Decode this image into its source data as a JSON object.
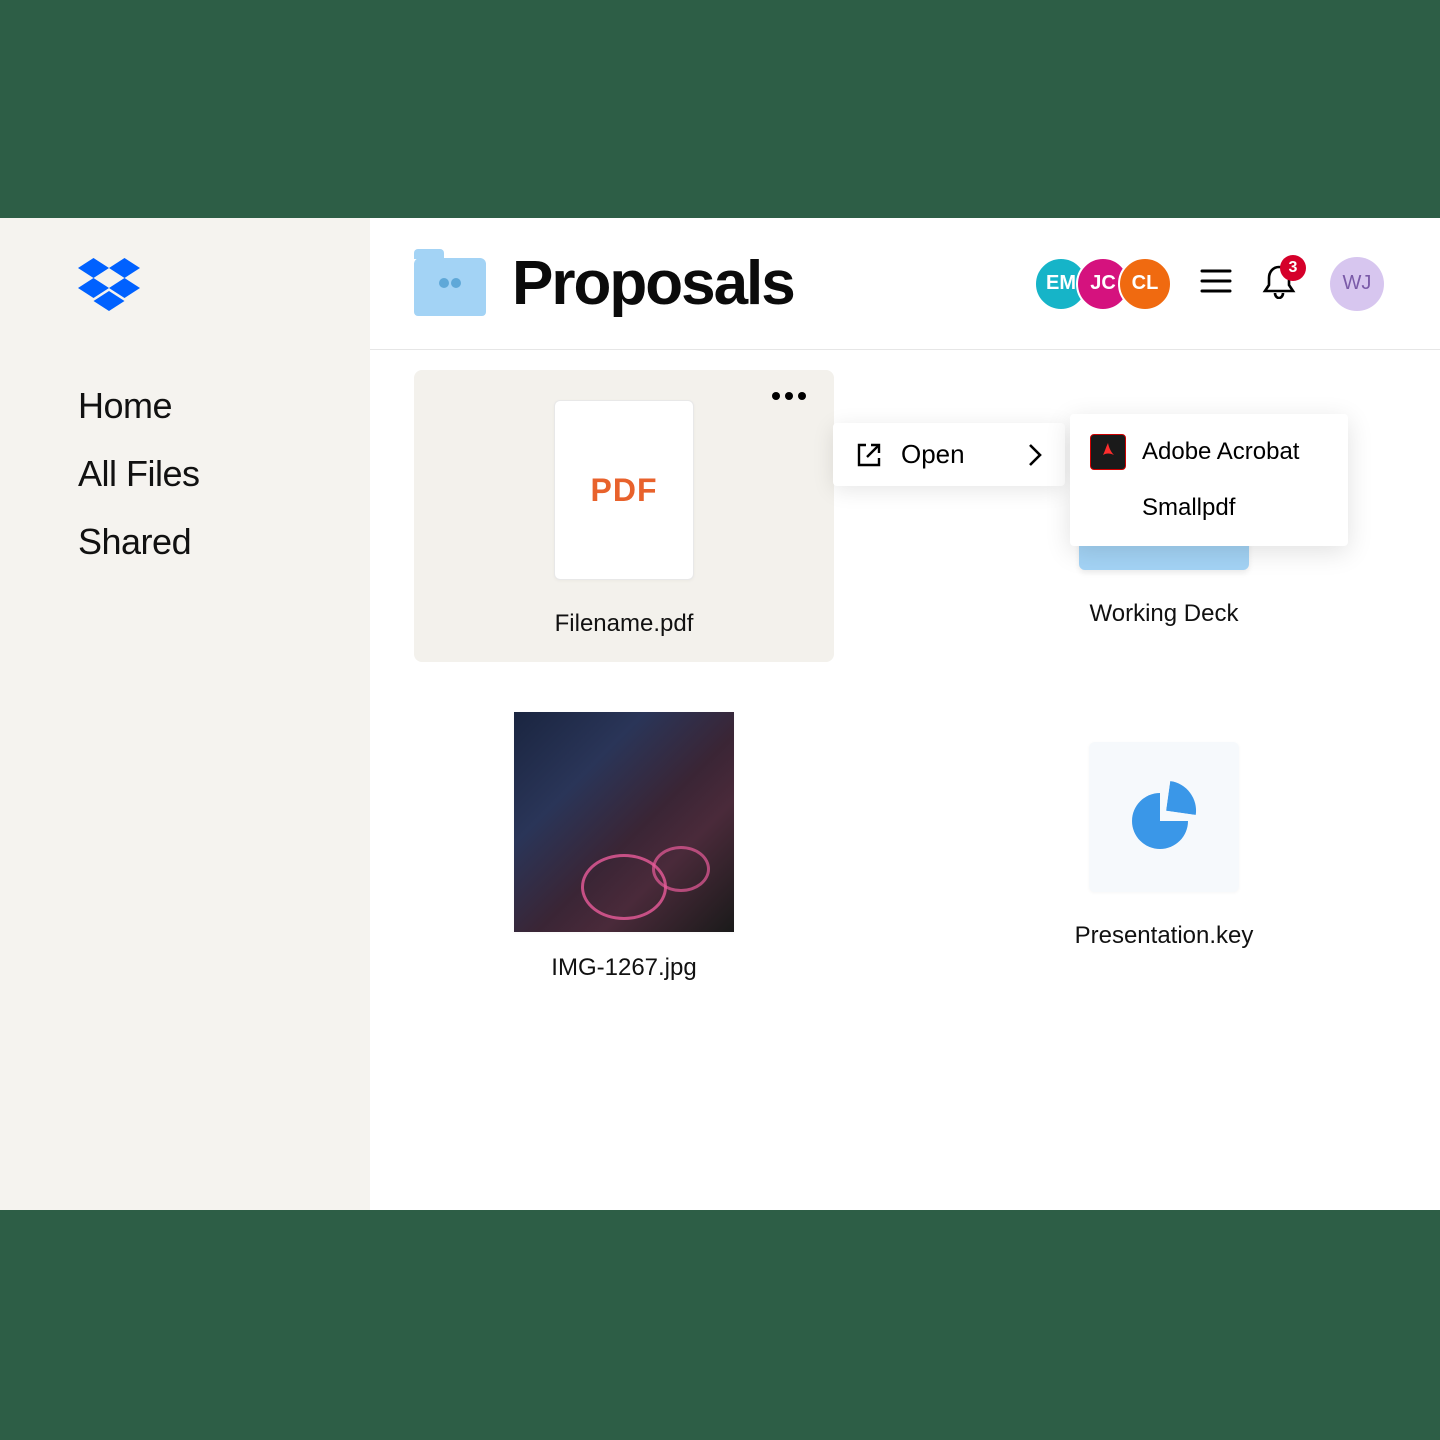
{
  "sidebar": {
    "items": [
      {
        "label": "Home"
      },
      {
        "label": "All Files"
      },
      {
        "label": "Shared"
      }
    ]
  },
  "header": {
    "title": "Proposals",
    "avatars": [
      {
        "initials": "EM",
        "bg": "#16b4c8"
      },
      {
        "initials": "JC",
        "bg": "#d5127e"
      },
      {
        "initials": "CL",
        "bg": "#f06a10"
      }
    ],
    "notification_count": "3",
    "user": {
      "initials": "WJ"
    }
  },
  "files": [
    {
      "name": "Filename.pdf",
      "type": "pdf",
      "pdf_label": "PDF"
    },
    {
      "name": "Working Deck",
      "type": "folder"
    },
    {
      "name": "IMG-1267.jpg",
      "type": "image"
    },
    {
      "name": "Presentation.key",
      "type": "key"
    }
  ],
  "context_menu": {
    "open_label": "Open",
    "apps": [
      {
        "label": "Adobe Acrobat"
      },
      {
        "label": "Smallpdf"
      }
    ]
  }
}
